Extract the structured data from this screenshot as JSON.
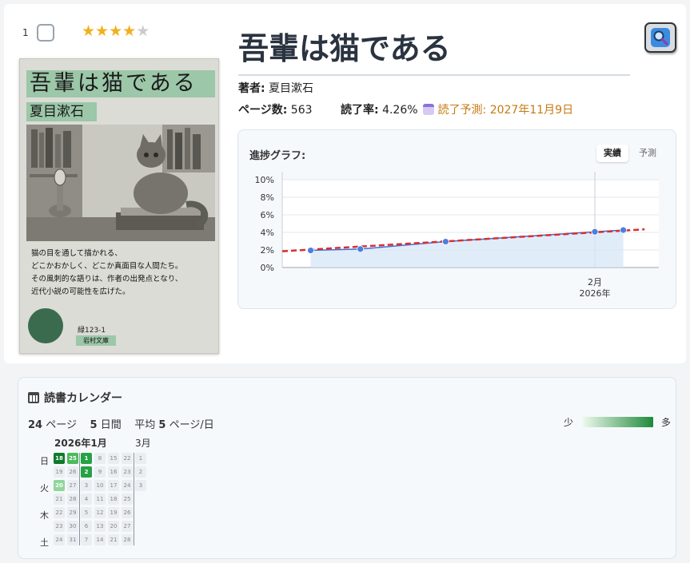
{
  "row": {
    "number": "1",
    "rating": 4,
    "rating_max": 5
  },
  "cover": {
    "title": "吾輩は猫である",
    "author": "夏目漱石",
    "blurb": [
      "猫の目を通して描かれる、",
      "どこかおかしく、どこか真面目な人間たち。",
      "その風刺的な語りは、作者の出発点となり、",
      "近代小説の可能性を広げた。"
    ],
    "code": "緑123-1",
    "publisher": "岩村文庫"
  },
  "book": {
    "title": "吾輩は猫である",
    "author_label": "著者:",
    "author": "夏目漱石",
    "pages_label": "ページ数:",
    "pages": "563",
    "progress_label": "読了率:",
    "progress": "4.26%",
    "prediction": "読了予測: 2027年11月9日"
  },
  "graph": {
    "label": "進捗グラフ:",
    "toggle_actual": "実績",
    "toggle_forecast": "予測"
  },
  "chart_data": {
    "type": "line",
    "ylim": [
      0,
      10
    ],
    "y_ticks": [
      "0%",
      "2%",
      "4%",
      "6%",
      "8%",
      "10%"
    ],
    "x_tick_labels": [
      "2月",
      "2026年"
    ],
    "series": [
      {
        "values": [
          [
            -40,
            1.95
          ],
          [
            -33,
            2.1
          ],
          [
            -21,
            2.95
          ],
          [
            0,
            4.07
          ],
          [
            4,
            4.26
          ]
        ]
      }
    ],
    "trend": [
      [
        -44,
        1.85
      ],
      [
        7,
        4.35
      ]
    ]
  },
  "calendar": {
    "title": "読書カレンダー",
    "stats": {
      "pages": "24",
      "pages_unit": "ページ",
      "days": "5",
      "days_unit": "日間",
      "avg_label": "平均",
      "avg": "5",
      "avg_unit": "ページ/日"
    },
    "legend_low": "少",
    "legend_high": "多",
    "months": [
      "2026年1月",
      "3月"
    ],
    "weekdays": [
      "日",
      "火",
      "木",
      "土"
    ],
    "weeks": [
      [
        [
          "18",
          4
        ],
        [
          "19",
          0
        ],
        [
          "20",
          1
        ],
        [
          "21",
          0
        ],
        [
          "22",
          0
        ],
        [
          "23",
          0
        ],
        [
          "24",
          0
        ]
      ],
      [
        [
          "25",
          2
        ],
        [
          "26",
          0
        ],
        [
          "27",
          0
        ],
        [
          "28",
          0
        ],
        [
          "29",
          0
        ],
        [
          "30",
          0
        ],
        [
          "31",
          0
        ]
      ],
      [
        [
          "1",
          3
        ],
        [
          "2",
          3
        ],
        [
          "3",
          0
        ],
        [
          "4",
          0
        ],
        [
          "5",
          0
        ],
        [
          "6",
          0
        ],
        [
          "7",
          0
        ]
      ],
      [
        [
          "8",
          0
        ],
        [
          "9",
          0
        ],
        [
          "10",
          0
        ],
        [
          "11",
          0
        ],
        [
          "12",
          0
        ],
        [
          "13",
          0
        ],
        [
          "14",
          0
        ]
      ],
      [
        [
          "15",
          0
        ],
        [
          "16",
          0
        ],
        [
          "17",
          0
        ],
        [
          "18",
          0
        ],
        [
          "19",
          0
        ],
        [
          "20",
          0
        ],
        [
          "21",
          0
        ]
      ],
      [
        [
          "22",
          0
        ],
        [
          "23",
          0
        ],
        [
          "24",
          0
        ],
        [
          "25",
          0
        ],
        [
          "26",
          0
        ],
        [
          "27",
          0
        ],
        [
          "28",
          0
        ]
      ],
      [
        [
          "1",
          0
        ],
        [
          "2",
          0
        ],
        [
          "3",
          0
        ]
      ]
    ]
  },
  "colors": {
    "accent_orange": "#c77a12",
    "line_blue": "#3f6fd6",
    "trend_red": "#d62f2f",
    "heat_dark": "#0f7a2c"
  }
}
